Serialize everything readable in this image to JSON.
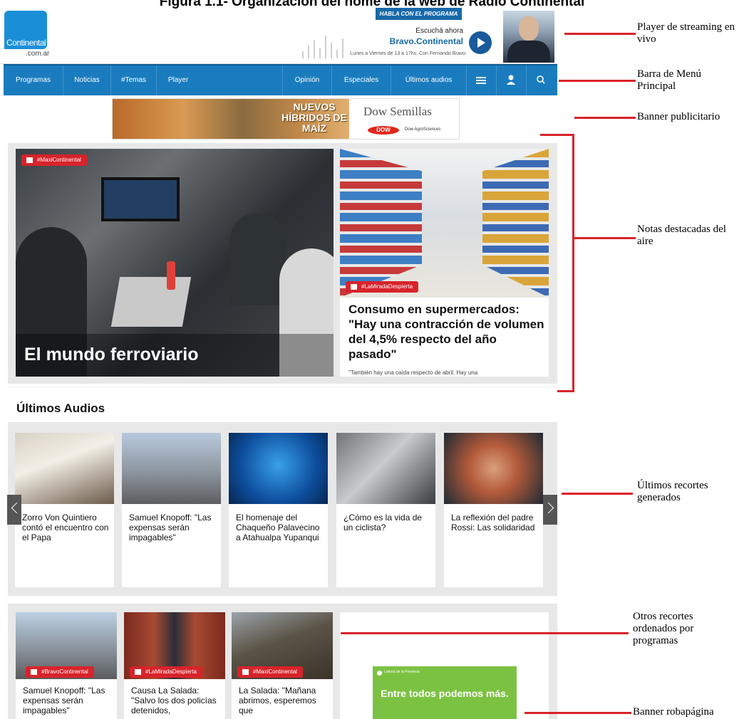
{
  "figure_title": "Figura 1.1- Organización del home de la web de Radio Continental",
  "header": {
    "logo_name": "Continental",
    "logo_tld": ".com.ar",
    "habla_button": "HABLA CON EL PROGRAMA",
    "escucha_label": "Escuchá ahora",
    "station": "Bravo.Continental",
    "schedule": "Lunes a Viernes de 13 a 17hs. Con Fernando Bravo."
  },
  "nav": {
    "items": [
      "Programas",
      "Noticias",
      "#Temas",
      "Player",
      "Opinión",
      "Especiales",
      "Últimos audios"
    ],
    "menu_icon": "hamburger-icon",
    "user_icon": "user-icon",
    "search_icon": "search-icon"
  },
  "ad_banner": {
    "headline": "NUEVOS HÍBRIDOS DE MAÍZ",
    "brand": "Dow Semillas",
    "logo": "DOW",
    "sub_brand": "Dow AgroSciences"
  },
  "featured": {
    "main": {
      "tag": "#MaxiContinental",
      "title": "El mundo ferroviario"
    },
    "side": {
      "tag": "#LaMiradaDespierta",
      "title": "Consumo en supermercados: \"Hay una contracción de volumen del 4,5% respecto del año pasado\"",
      "excerpt": "\"También hay una caída respecto de abril. Hay una"
    }
  },
  "ultimos_audios": {
    "heading": "Últimos Audios",
    "items": [
      "Zorro Von Quintiero contó el encuentro con el Papa",
      "Samuel Knopoff: \"Las expensas serán impagables\"",
      "El homenaje del Chaqueño Palavecino a Atahualpa Yupanqui",
      "¿Cómo es la vida de un ciclista?",
      "La reflexión del padre Rossi: Las solidaridad"
    ]
  },
  "programas": {
    "items": [
      {
        "tag": "#BravoContinental",
        "title": "Samuel Knopoff: \"Las expensas serán impagables\""
      },
      {
        "tag": "#LaMiradaDespierta",
        "title": "Causa La Salada: \"Salvo los dos policías detenidos,"
      },
      {
        "tag": "#MaxiContinental",
        "title": "La Salada: \"Mañana abrimos, esperemos que"
      }
    ]
  },
  "robapagina": {
    "brand": "Lotería de la Provincia",
    "message": "Entre todos podemos más."
  },
  "annotations": {
    "player": "Player de streaming en vivo",
    "menu": "Barra de Menú Principal",
    "banner": "Banner publicitario",
    "destacadas": "Notas destacadas del aire",
    "recortes": "Últimos recortes generados",
    "otros": "Otros recortes ordenados por programas",
    "robapagina": "Banner robapágina"
  },
  "colors": {
    "nav_blue": "#1a7cbe",
    "tag_red": "#d8232a",
    "annotation_red": "#d8232a",
    "promo_green": "#7cc242"
  }
}
